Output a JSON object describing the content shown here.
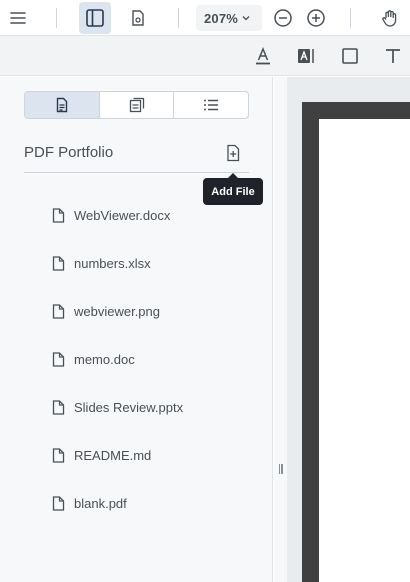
{
  "toolbar": {
    "zoom_value": "207%",
    "icons": [
      "menu-icon",
      "left-panel-toggle-icon",
      "document-settings-icon",
      "zoom-dropdown-chevron-icon",
      "zoom-out-icon",
      "zoom-in-icon",
      "pan-hand-icon"
    ],
    "active_color": "#dce4ef"
  },
  "annotation_tools": {
    "icons": [
      "text-underline-tool-icon",
      "free-text-tool-icon",
      "rectangle-tool-icon",
      "text-tool-icon"
    ]
  },
  "left_panel": {
    "tabs": [
      {
        "name": "thumbnails-tab",
        "icon": "document-icon",
        "active": true
      },
      {
        "name": "portfolio-tab",
        "icon": "portfolio-icon",
        "active": false
      },
      {
        "name": "outline-tab",
        "icon": "list-icon",
        "active": false
      }
    ],
    "portfolio_title": "PDF Portfolio",
    "add_file_tooltip": "Add File",
    "files": [
      {
        "name": "WebViewer.docx"
      },
      {
        "name": "numbers.xlsx"
      },
      {
        "name": "webviewer.png"
      },
      {
        "name": "memo.doc"
      },
      {
        "name": "Slides Review.pptx"
      },
      {
        "name": "README.md"
      },
      {
        "name": "blank.pdf"
      }
    ]
  }
}
